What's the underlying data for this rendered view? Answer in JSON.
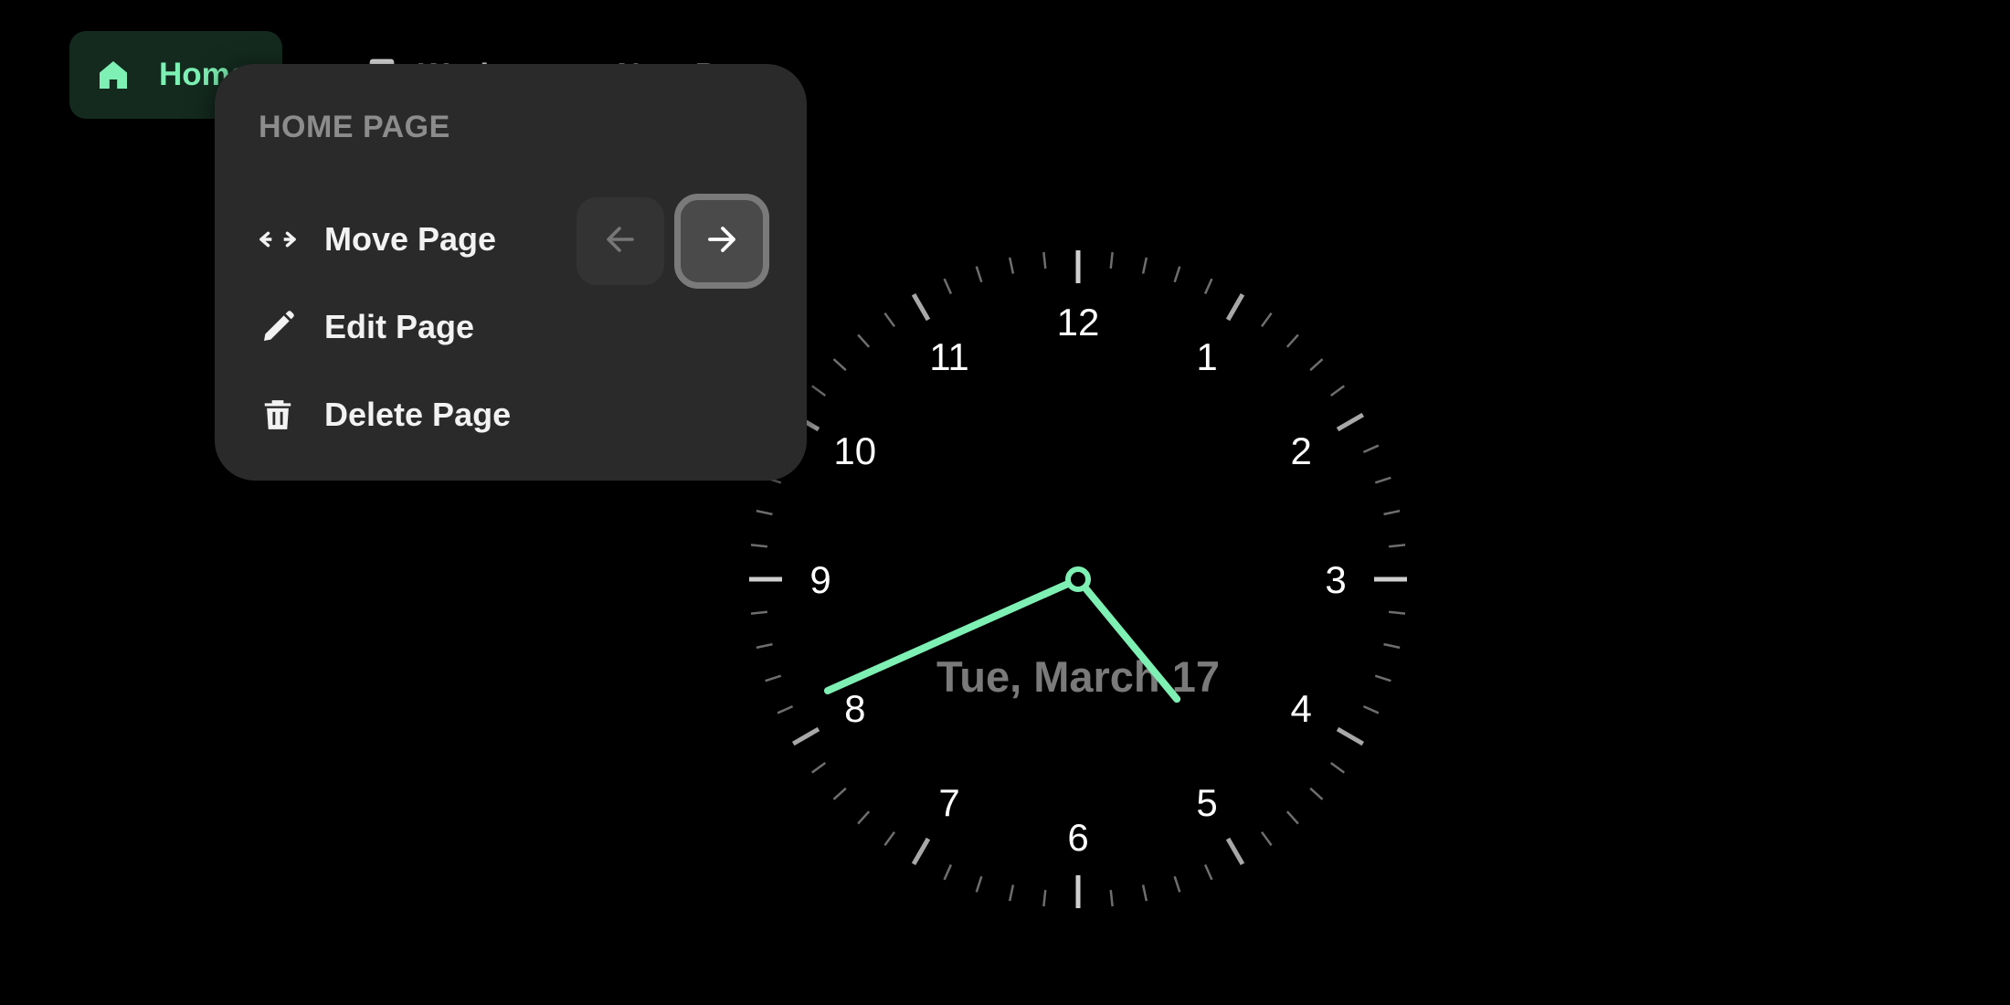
{
  "tabs": [
    {
      "label": "Home",
      "icon": "home-icon",
      "active": true
    },
    {
      "label": "Workspace · Next Page",
      "icon": "page-icon",
      "active": false
    }
  ],
  "menu": {
    "title": "HOME PAGE",
    "items": [
      {
        "label": "Move Page",
        "icon": "move-arrows-icon"
      },
      {
        "label": "Edit Page",
        "icon": "pencil-icon"
      },
      {
        "label": "Delete Page",
        "icon": "trash-icon"
      }
    ],
    "move_left_icon": "arrow-left-icon",
    "move_right_icon": "arrow-right-icon"
  },
  "clock": {
    "numbers": [
      "12",
      "1",
      "2",
      "3",
      "4",
      "5",
      "6",
      "7",
      "8",
      "9",
      "10",
      "11"
    ],
    "date": "Tue, March 17",
    "time": {
      "hour": 4,
      "minute": 41
    }
  },
  "colors": {
    "accent": "#7ef0b4",
    "background": "#000000",
    "menu_bg": "#2a2a2a",
    "tick": "#8a8a8a"
  }
}
